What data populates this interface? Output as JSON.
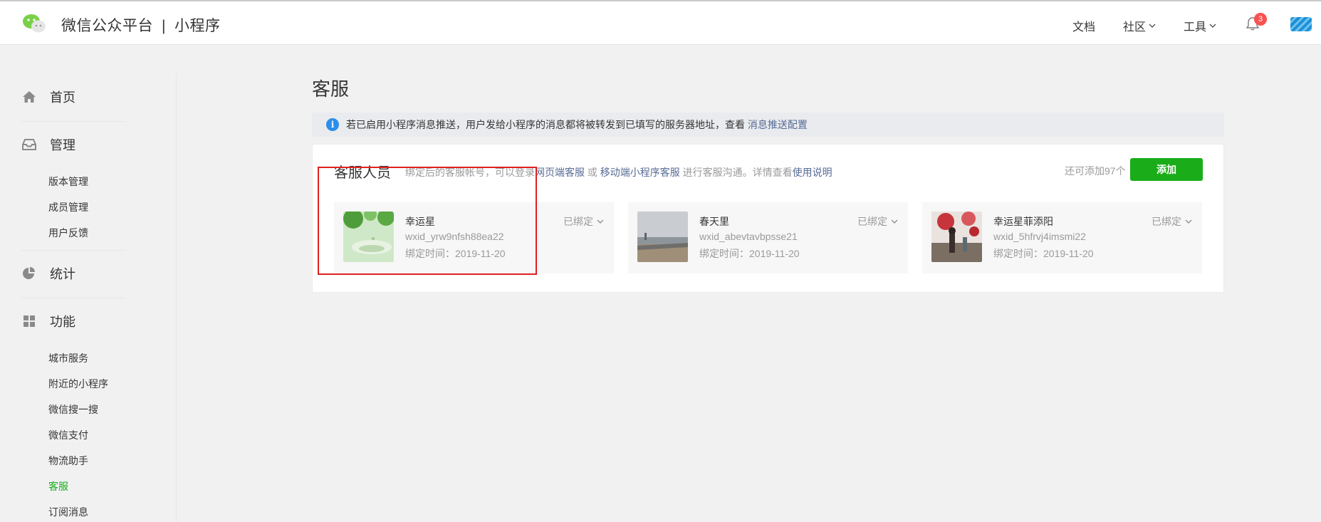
{
  "header": {
    "brand_main": "微信公众平台",
    "brand_sep": "|",
    "brand_sub": "小程序",
    "nav": [
      {
        "label": "文档",
        "has_dropdown": false
      },
      {
        "label": "社区",
        "has_dropdown": true
      },
      {
        "label": "工具",
        "has_dropdown": true
      }
    ],
    "notification_count": "3"
  },
  "sidebar": {
    "home": "首页",
    "manage": {
      "label": "管理",
      "items": [
        "版本管理",
        "成员管理",
        "用户反馈"
      ]
    },
    "stats": "统计",
    "features": {
      "label": "功能",
      "items": [
        "城市服务",
        "附近的小程序",
        "微信搜一搜",
        "微信支付",
        "物流助手",
        "客服",
        "订阅消息"
      ],
      "active": "客服"
    }
  },
  "main": {
    "title": "客服",
    "notice": {
      "text": "若已启用小程序消息推送，用户发给小程序的消息都将被转发到已填写的服务器地址，查看",
      "link": "消息推送配置"
    },
    "panel": {
      "title": "客服人员",
      "desc_prefix": "绑定后的客服帐号，可以登录",
      "link_web": "网页端客服",
      "desc_or": "或",
      "link_mobile": "移动端小程序客服",
      "desc_mid": "进行客服沟通。详情查看",
      "link_help": "使用说明",
      "remain": "还可添加97个",
      "add_label": "添加"
    },
    "agents": [
      {
        "name": "幸运星",
        "wxid": "wxid_yrw9nfsh88ea22",
        "bind_time": "绑定时间：2019-11-20",
        "status": "已绑定"
      },
      {
        "name": "春天里",
        "wxid": "wxid_abevtavbpsse21",
        "bind_time": "绑定时间：2019-11-20",
        "status": "已绑定"
      },
      {
        "name": "幸运星菲添阳",
        "wxid": "wxid_5hfrvj4imsmi22",
        "bind_time": "绑定时间：2019-11-20",
        "status": "已绑定"
      }
    ]
  },
  "colors": {
    "accent_green": "#1aad19",
    "link_blue": "#576b95",
    "badge_red": "#fa5151",
    "highlight_red": "#e02020",
    "info_blue": "#2b8eea"
  }
}
